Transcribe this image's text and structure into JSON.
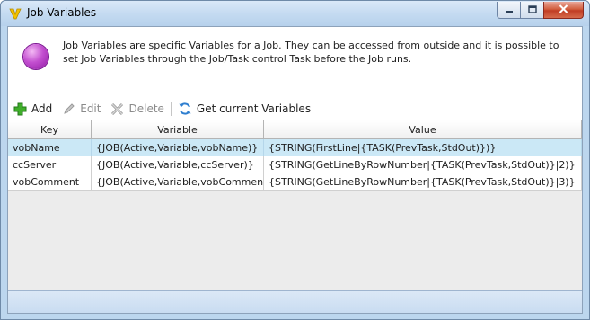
{
  "window": {
    "title": "Job Variables",
    "icon": "app-logo-v",
    "accent": "#f2c200"
  },
  "info": {
    "icon": "purple-circle-icon",
    "text": "Job Variables are specific Variables for a Job. They can be accessed from outside and it is possible to set Job Variables through the Job/Task control Task before the Job runs."
  },
  "toolbar": {
    "add_label": "Add",
    "edit_label": "Edit",
    "delete_label": "Delete",
    "get_label": "Get current Variables"
  },
  "grid": {
    "columns": [
      "Key",
      "Variable",
      "Value"
    ],
    "rows": [
      {
        "key": "vobName",
        "variable": "{JOB(Active,Variable,vobName)}",
        "value": "{STRING(FirstLine|{TASK(PrevTask,StdOut)})}",
        "selected": true
      },
      {
        "key": "ccServer",
        "variable": "{JOB(Active,Variable,ccServer)}",
        "value": "{STRING(GetLineByRowNumber|{TASK(PrevTask,StdOut)}|2)}",
        "selected": false
      },
      {
        "key": "vobComment",
        "variable": "{JOB(Active,Variable,vobComment)}",
        "value": "{STRING(GetLineByRowNumber|{TASK(PrevTask,StdOut)}|3)}",
        "selected": false
      }
    ]
  },
  "colors": {
    "selected_row": "#cbe8f6",
    "frame": "#bcd6ee",
    "close_button": "#c13d24"
  }
}
